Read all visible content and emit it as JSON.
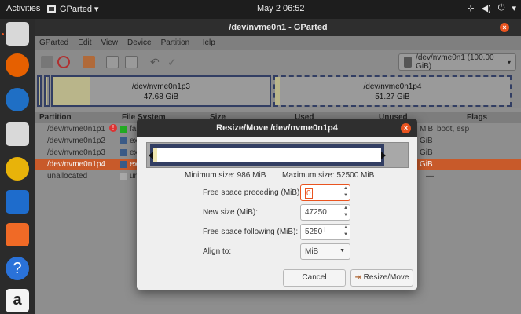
{
  "topbar": {
    "activities": "Activities",
    "app_name": "GParted ▾",
    "clock": "May 2  06:52",
    "tray_icons": [
      "network-icon",
      "volume-icon",
      "power-icon",
      "chevron-down-icon"
    ]
  },
  "dock": {
    "items": [
      "help-icon",
      "firefox-icon",
      "thunderbird-icon",
      "files-icon",
      "rhythmbox-icon",
      "writer-icon",
      "software-icon",
      "help-icon",
      "amazon-icon"
    ]
  },
  "window": {
    "title": "/dev/nvme0n1 - GParted",
    "menu": [
      "GParted",
      "Edit",
      "View",
      "Device",
      "Partition",
      "Help"
    ],
    "device_selector": "/dev/nvme0n1  (100.00 GiB)",
    "diskmap": {
      "p3": {
        "name": "/dev/nvme0n1p3",
        "size": "47.68 GiB"
      },
      "p4": {
        "name": "/dev/nvme0n1p4",
        "size": "51.27 GiB"
      }
    },
    "columns": {
      "partition": "Partition",
      "filesystem": "File System",
      "size": "Size",
      "used": "Used",
      "unused": "Unused",
      "flags": "Flags"
    },
    "rows": [
      {
        "partition": "/dev/nvme0n1p1",
        "fs": "fa",
        "unused": "MiB",
        "flags": "boot, esp",
        "color": "#22aa22"
      },
      {
        "partition": "/dev/nvme0n1p2",
        "fs": "ex",
        "unused": "GiB",
        "flags": "",
        "color": "#3b5b87"
      },
      {
        "partition": "/dev/nvme0n1p3",
        "fs": "ex",
        "unused": "GiB",
        "flags": "",
        "color": "#3b5b87"
      },
      {
        "partition": "/dev/nvme0n1p4",
        "fs": "ex",
        "unused": "GiB",
        "flags": "",
        "color": "#3b5b87"
      },
      {
        "partition": "unallocated",
        "fs": "ur",
        "unused": "—",
        "flags": "",
        "color": "#a8a8a8"
      }
    ]
  },
  "dialog": {
    "title": "Resize/Move /dev/nvme0n1p4",
    "min_size": "Minimum size: 986 MiB",
    "max_size": "Maximum size: 52500 MiB",
    "fields": {
      "preceding_label": "Free space preceding (MiB):",
      "preceding_value": "0",
      "newsize_label": "New size (MiB):",
      "newsize_value": "47250",
      "following_label": "Free space following (MiB):",
      "following_value": "5250",
      "align_label": "Align to:",
      "align_value": "MiB"
    },
    "cancel": "Cancel",
    "resize_move": "Resize/Move"
  },
  "colors": {
    "accent": "#e95420",
    "partition_border": "#323e63",
    "used_space": "#efe6b0",
    "selected_row": "#c85a2a"
  }
}
